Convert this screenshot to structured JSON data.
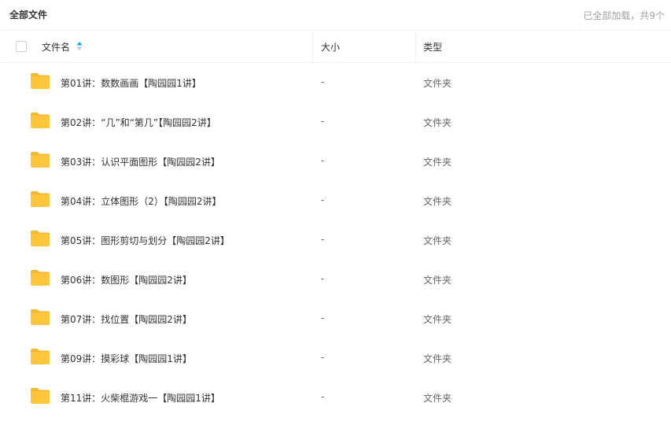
{
  "topbar": {
    "title": "全部文件",
    "status": "已全部加载，共9个"
  },
  "header": {
    "name_label": "文件名",
    "size_label": "大小",
    "type_label": "类型",
    "sort_icon": "sort-ascending-icon"
  },
  "folder_icon": "folder-icon",
  "colors": {
    "folder": "#ffc63d",
    "folder_dark": "#f5b72b",
    "sort_active": "#06a7ff",
    "sort_inactive": "#c8c8c8"
  },
  "files": [
    {
      "name": "第01讲：数数画画【陶园园1讲】",
      "size": "-",
      "type": "文件夹"
    },
    {
      "name": "第02讲：“几”和“第几”【陶园园2讲】",
      "size": "-",
      "type": "文件夹"
    },
    {
      "name": "第03讲：认识平面图形【陶园园2讲】",
      "size": "-",
      "type": "文件夹"
    },
    {
      "name": "第04讲：立体图形（2）【陶园园2讲】",
      "size": "-",
      "type": "文件夹"
    },
    {
      "name": "第05讲：图形剪切与划分【陶园园2讲】",
      "size": "-",
      "type": "文件夹"
    },
    {
      "name": "第06讲：数图形【陶园园2讲】",
      "size": "-",
      "type": "文件夹"
    },
    {
      "name": "第07讲：找位置【陶园园2讲】",
      "size": "-",
      "type": "文件夹"
    },
    {
      "name": "第09讲：摸彩球【陶园园1讲】",
      "size": "-",
      "type": "文件夹"
    },
    {
      "name": "第11讲：火柴棍游戏一【陶园园1讲】",
      "size": "-",
      "type": "文件夹"
    }
  ]
}
